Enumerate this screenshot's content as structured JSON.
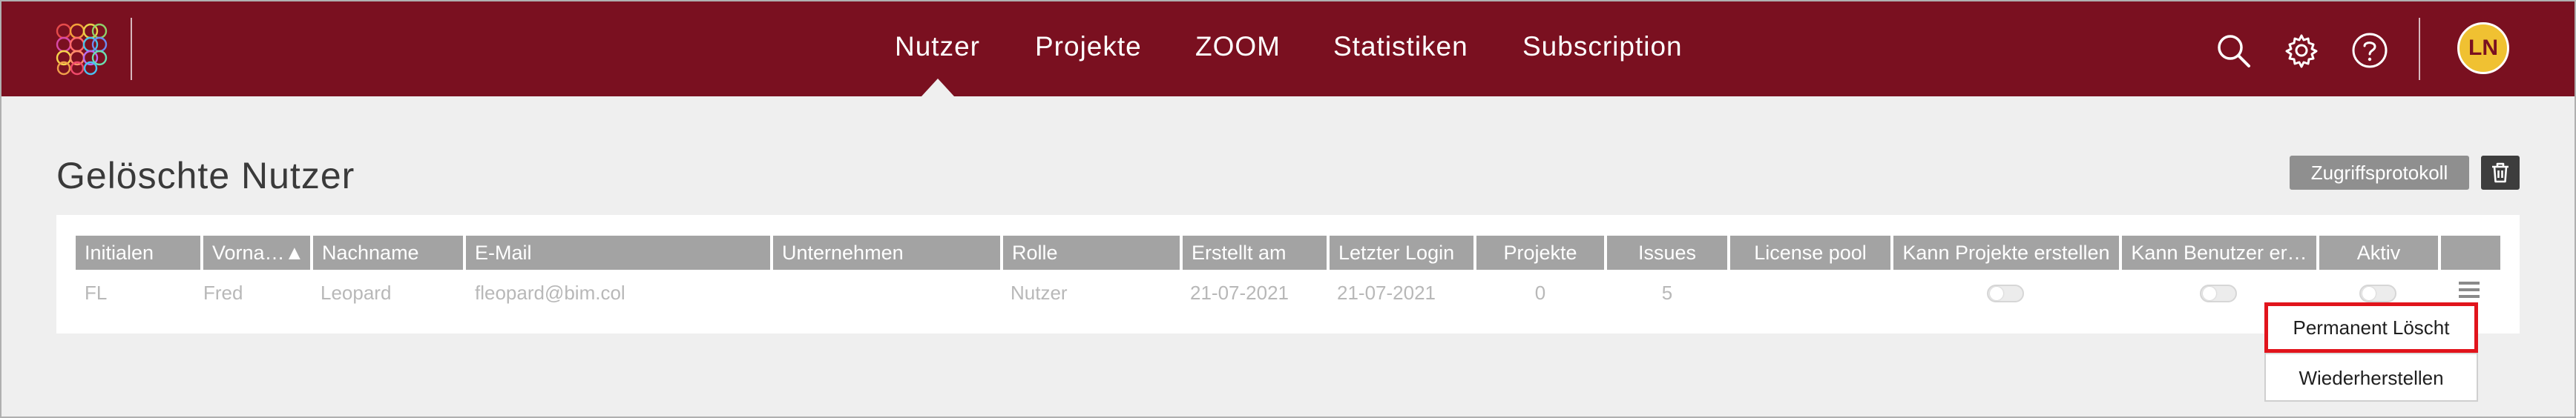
{
  "nav": {
    "items": [
      "Nutzer",
      "Projekte",
      "ZOOM",
      "Statistiken",
      "Subscription"
    ],
    "active": "Nutzer"
  },
  "header_icons": [
    "search-icon",
    "gear-icon",
    "help-icon"
  ],
  "user": {
    "initials": "LN"
  },
  "page": {
    "title": "Gelöschte Nutzer"
  },
  "actions": {
    "access_log_label": "Zugriffsprotokoll",
    "trash_icon": "trash-icon"
  },
  "table": {
    "headers": [
      "Initialen",
      "Vorna…▲",
      "Nachname",
      "E-Mail",
      "Unternehmen",
      "Rolle",
      "Erstellt am",
      "Letzter Login",
      "Projekte",
      "Issues",
      "License pool",
      "Kann Projekte erstellen",
      "Kann Benutzer er…",
      "Aktiv",
      ""
    ],
    "rows": [
      {
        "initials": "FL",
        "first_name": "Fred",
        "last_name": "Leopard",
        "email": "fleopard@bim.col",
        "company": "",
        "role": "Nutzer",
        "created": "21-07-2021",
        "last_login": "21-07-2021",
        "projects": "0",
        "issues": "5",
        "license_pool": "",
        "can_create_projects": false,
        "can_create_users": false,
        "active": false
      }
    ]
  },
  "row_menu": {
    "items": [
      "Permanent Löscht",
      "Wiederherstellen"
    ],
    "highlighted": "Permanent Löscht"
  },
  "colors": {
    "brand": "#7a1020",
    "avatar": "#f0c132",
    "highlight": "#e1141c",
    "header_cell": "#a3a3a3"
  }
}
